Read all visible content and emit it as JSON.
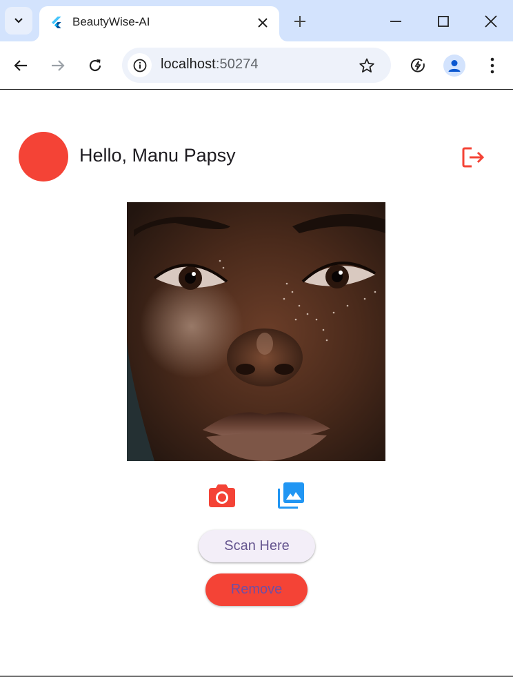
{
  "browser": {
    "tab_title": "BeautyWise-AI",
    "url_host": "localhost",
    "url_port": ":50274"
  },
  "icons": {
    "tab_search": "chevron-down-icon",
    "favicon": "flutter-logo-icon",
    "tab_close": "close-icon",
    "new_tab": "plus-icon",
    "minimize": "minimize-icon",
    "maximize": "maximize-icon",
    "close_window": "close-icon",
    "back": "arrow-left-icon",
    "forward": "arrow-right-icon",
    "reload": "reload-icon",
    "site_info": "info-icon",
    "bookmark": "star-icon",
    "performance": "speed-leaf-icon",
    "profile": "person-icon",
    "menu": "more-vert-icon",
    "logout": "logout-icon",
    "camera": "camera-icon",
    "gallery": "photo-library-icon"
  },
  "app": {
    "greeting": "Hello, Manu Papsy",
    "scan_label": "Scan Here",
    "remove_label": "Remove"
  },
  "colors": {
    "accent_red": "#f44336",
    "accent_blue": "#2196f3",
    "scan_bg": "#f3eef8",
    "scan_text": "#65558f",
    "tabbar_bg": "#d3e3fd"
  }
}
